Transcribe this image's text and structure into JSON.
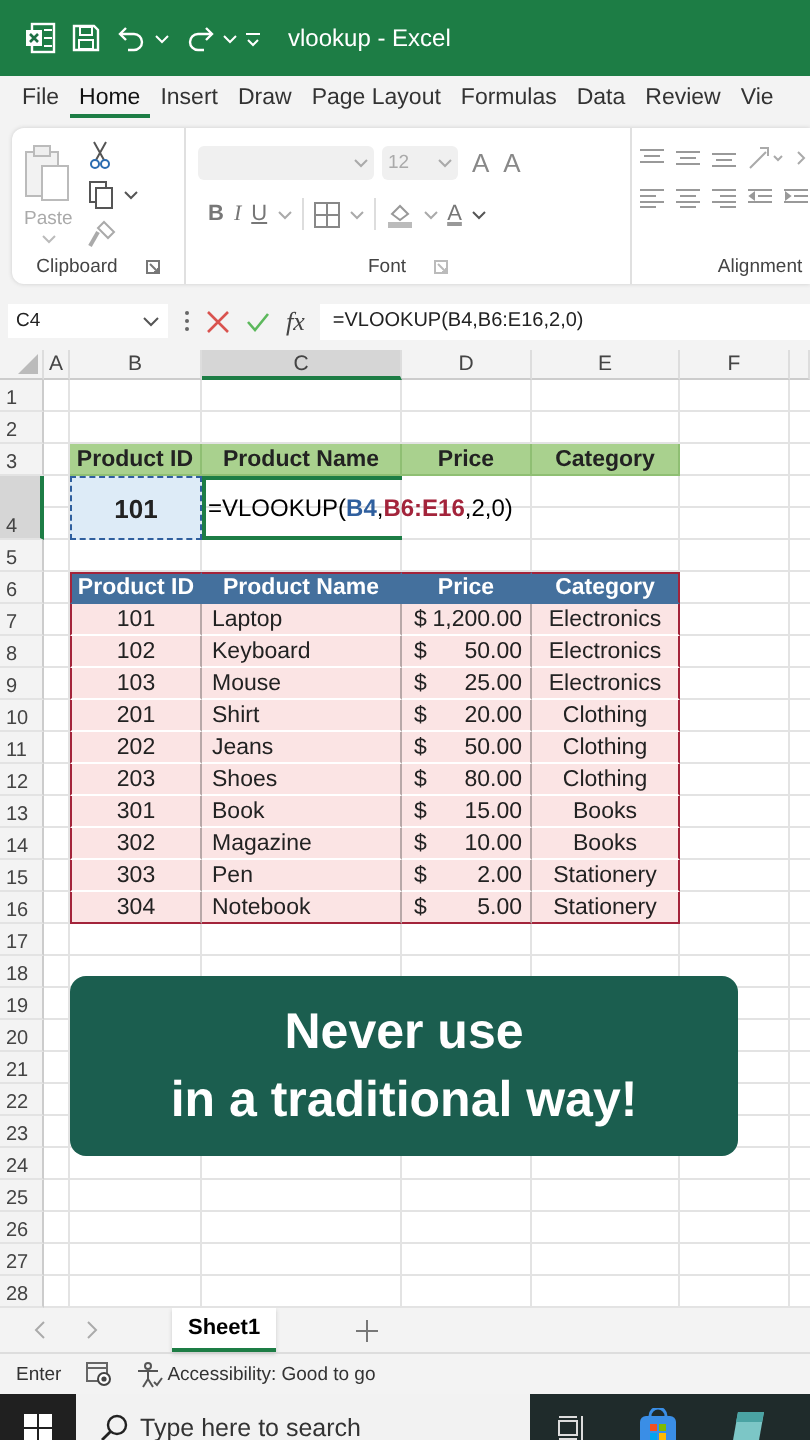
{
  "title_bar": {
    "title": "vlookup - Excel"
  },
  "menu_tabs": [
    {
      "label": "File",
      "selected": false
    },
    {
      "label": "Home",
      "selected": true
    },
    {
      "label": "Insert",
      "selected": false
    },
    {
      "label": "Draw",
      "selected": false
    },
    {
      "label": "Page Layout",
      "selected": false
    },
    {
      "label": "Formulas",
      "selected": false
    },
    {
      "label": "Data",
      "selected": false
    },
    {
      "label": "Review",
      "selected": false
    },
    {
      "label": "Vie",
      "selected": false
    }
  ],
  "ribbon": {
    "clipboard": {
      "paste_label": "Paste",
      "group_label": "Clipboard"
    },
    "font": {
      "size": "12",
      "grow": "A",
      "shrink": "A",
      "bold": "B",
      "italic": "I",
      "underline": "U",
      "font_color_letter": "A",
      "group_label": "Font"
    },
    "alignment": {
      "group_label": "Alignment"
    }
  },
  "formula_bar": {
    "name_box": "C4",
    "fx": "fx",
    "formula": "=VLOOKUP(B4,B6:E16,2,0)"
  },
  "sheet": {
    "columns": [
      {
        "label": "A",
        "selected": false
      },
      {
        "label": "B",
        "selected": false
      },
      {
        "label": "C",
        "selected": true
      },
      {
        "label": "D",
        "selected": false
      },
      {
        "label": "E",
        "selected": false
      },
      {
        "label": "F",
        "selected": false
      }
    ],
    "rows": [
      {
        "number": "1",
        "selected": false
      },
      {
        "number": "2",
        "selected": false
      },
      {
        "number": "3",
        "selected": false,
        "kind": "lookup-header",
        "cells": [
          "Product ID",
          "Product Name",
          "Price",
          "Category"
        ]
      },
      {
        "number": "4",
        "selected": true,
        "kind": "lookup-input",
        "cells": [
          "101"
        ],
        "formula_parts": [
          {
            "text": "=VLOOKUP(",
            "color": "#000000"
          },
          {
            "text": "B4",
            "color": "#2f5f9e"
          },
          {
            "text": ",",
            "color": "#000000"
          },
          {
            "text": "B6:E16",
            "color": "#a3243b"
          },
          {
            "text": ",2,0)",
            "color": "#000000"
          }
        ]
      },
      {
        "number": "5",
        "selected": false
      },
      {
        "number": "6",
        "selected": false,
        "kind": "table-header",
        "cells": [
          "Product ID",
          "Product Name",
          "Price",
          "Category"
        ]
      },
      {
        "number": "7",
        "selected": false,
        "kind": "table-row",
        "id": "101",
        "name": "Laptop",
        "price": {
          "currency": "$",
          "amount": "1,200.00"
        },
        "category": "Electronics"
      },
      {
        "number": "8",
        "selected": false,
        "kind": "table-row",
        "id": "102",
        "name": "Keyboard",
        "price": {
          "currency": "$",
          "amount": "50.00"
        },
        "category": "Electronics"
      },
      {
        "number": "9",
        "selected": false,
        "kind": "table-row",
        "id": "103",
        "name": "Mouse",
        "price": {
          "currency": "$",
          "amount": "25.00"
        },
        "category": "Electronics"
      },
      {
        "number": "10",
        "selected": false,
        "kind": "table-row",
        "id": "201",
        "name": "Shirt",
        "price": {
          "currency": "$",
          "amount": "20.00"
        },
        "category": "Clothing"
      },
      {
        "number": "11",
        "selected": false,
        "kind": "table-row",
        "id": "202",
        "name": "Jeans",
        "price": {
          "currency": "$",
          "amount": "50.00"
        },
        "category": "Clothing"
      },
      {
        "number": "12",
        "selected": false,
        "kind": "table-row",
        "id": "203",
        "name": "Shoes",
        "price": {
          "currency": "$",
          "amount": "80.00"
        },
        "category": "Clothing"
      },
      {
        "number": "13",
        "selected": false,
        "kind": "table-row",
        "id": "301",
        "name": "Book",
        "price": {
          "currency": "$",
          "amount": "15.00"
        },
        "category": "Books"
      },
      {
        "number": "14",
        "selected": false,
        "kind": "table-row",
        "id": "302",
        "name": "Magazine",
        "price": {
          "currency": "$",
          "amount": "10.00"
        },
        "category": "Books"
      },
      {
        "number": "15",
        "selected": false,
        "kind": "table-row",
        "id": "303",
        "name": "Pen",
        "price": {
          "currency": "$",
          "amount": "2.00"
        },
        "category": "Stationery"
      },
      {
        "number": "16",
        "selected": false,
        "kind": "table-row",
        "id": "304",
        "name": "Notebook",
        "price": {
          "currency": "$",
          "amount": "5.00"
        },
        "category": "Stationery"
      },
      {
        "number": "17",
        "selected": false
      },
      {
        "number": "18",
        "selected": false
      },
      {
        "number": "19",
        "selected": false
      },
      {
        "number": "20",
        "selected": false
      },
      {
        "number": "21",
        "selected": false
      },
      {
        "number": "22",
        "selected": false
      },
      {
        "number": "23",
        "selected": false
      },
      {
        "number": "24",
        "selected": false
      },
      {
        "number": "25",
        "selected": false
      },
      {
        "number": "26",
        "selected": false
      },
      {
        "number": "27",
        "selected": false
      },
      {
        "number": "28",
        "selected": false
      }
    ]
  },
  "banner": {
    "lines": [
      "Never use",
      "in a traditional way!"
    ]
  },
  "sheet_tabs": [
    {
      "label": "Sheet1",
      "selected": true
    }
  ],
  "status_bar": {
    "mode": "Enter",
    "accessibility": "Accessibility: Good to go"
  },
  "taskbar": {
    "search": {
      "placeholder": "Type here to search"
    }
  }
}
